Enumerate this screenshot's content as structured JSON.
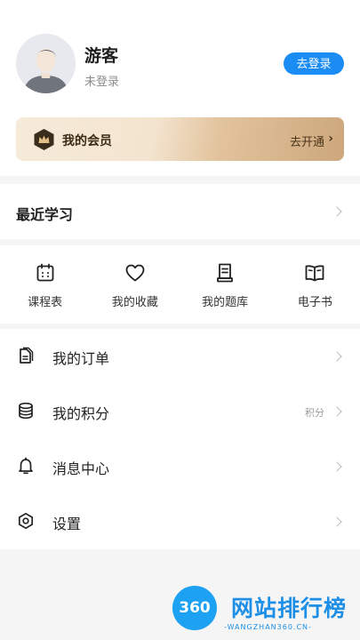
{
  "profile": {
    "name": "游客",
    "status": "未登录",
    "login_label": "去登录"
  },
  "vip": {
    "label": "我的会员",
    "action": "去开通",
    "arrow": "›"
  },
  "recent": {
    "title": "最近学习"
  },
  "quick_links": [
    {
      "label": "课程表",
      "icon": "calendar-icon"
    },
    {
      "label": "我的收藏",
      "icon": "heart-icon"
    },
    {
      "label": "我的题库",
      "icon": "question-bank-icon"
    },
    {
      "label": "电子书",
      "icon": "book-icon"
    }
  ],
  "menu": [
    {
      "label": "我的订单",
      "icon": "orders-icon",
      "extra": ""
    },
    {
      "label": "我的积分",
      "icon": "points-icon",
      "extra": "积分"
    },
    {
      "label": "消息中心",
      "icon": "bell-icon",
      "extra": ""
    },
    {
      "label": "设置",
      "icon": "settings-icon",
      "extra": ""
    }
  ],
  "watermark": {
    "logo_text": "360",
    "title": "网站排行榜",
    "subtitle": "-WANGZHAN360.CN-"
  },
  "colors": {
    "accent": "#1a8cf3",
    "vip_gold": "#cda77c"
  }
}
